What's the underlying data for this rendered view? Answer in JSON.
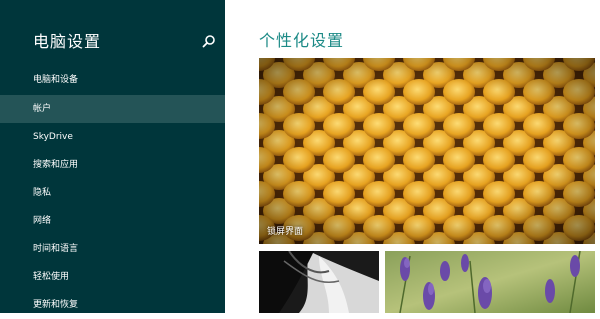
{
  "sidebar": {
    "title": "电脑设置",
    "search_icon": "search-icon",
    "items": [
      {
        "label": "电脑和设备",
        "selected": false
      },
      {
        "label": "帐户",
        "selected": true
      },
      {
        "label": "SkyDrive",
        "selected": false
      },
      {
        "label": "搜索和应用",
        "selected": false
      },
      {
        "label": "隐私",
        "selected": false
      },
      {
        "label": "网络",
        "selected": false
      },
      {
        "label": "时间和语言",
        "selected": false
      },
      {
        "label": "轻松使用",
        "selected": false
      },
      {
        "label": "更新和恢复",
        "selected": false
      }
    ]
  },
  "main": {
    "title": "个性化设置",
    "tiles": [
      {
        "label": "锁屏界面",
        "image": "honeycomb-image"
      },
      {
        "label": "",
        "image": "portrait-image"
      },
      {
        "label": "",
        "image": "lavender-image"
      }
    ]
  },
  "colors": {
    "sidebar_bg": "#00363b",
    "selected_bg": "#245457",
    "accent": "#1c8a86"
  }
}
